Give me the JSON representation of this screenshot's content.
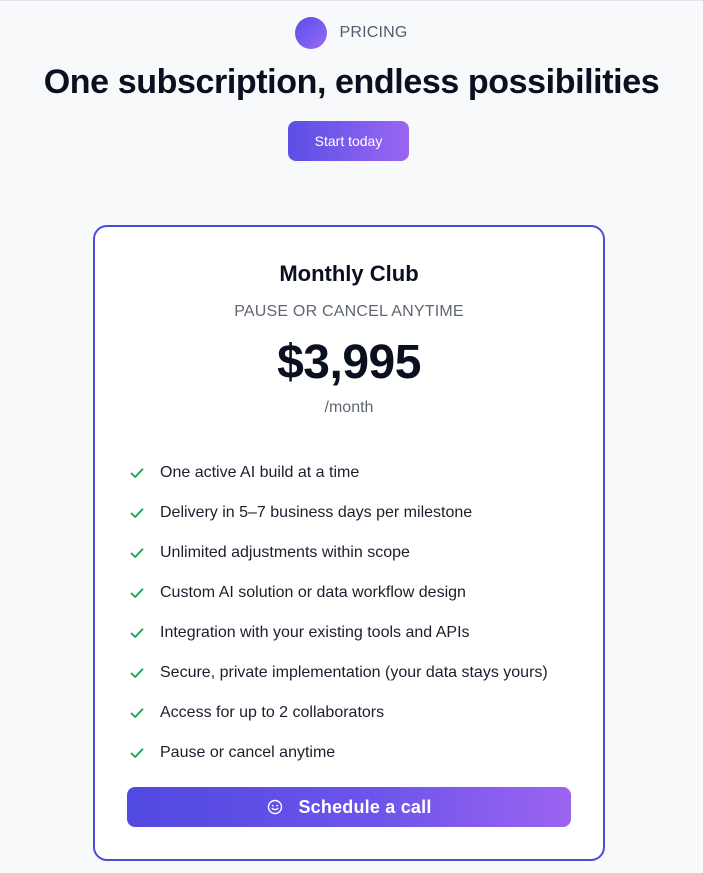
{
  "header": {
    "eyebrow": "PRICING",
    "headline": "One subscription, endless possibilities",
    "start_button": "Start today"
  },
  "plan": {
    "name": "Monthly Club",
    "subtitle": "PAUSE OR CANCEL ANYTIME",
    "price": "$3,995",
    "period": "/month",
    "features": [
      "One active AI build at a time",
      "Delivery in 5–7 business days per milestone",
      "Unlimited adjustments within scope",
      "Custom AI solution or data workflow design",
      "Integration with your existing tools and APIs",
      "Secure, private implementation (your data stays yours)",
      "Access for up to 2 collaborators",
      "Pause or cancel anytime"
    ],
    "feature_icon": "check-icon",
    "cta_label": "Schedule a call",
    "cta_icon": "smile-icon"
  },
  "colors": {
    "accent_start": "#5149e0",
    "accent_end": "#9b64f0",
    "card_border": "#5149d8",
    "check": "#16a34a"
  }
}
